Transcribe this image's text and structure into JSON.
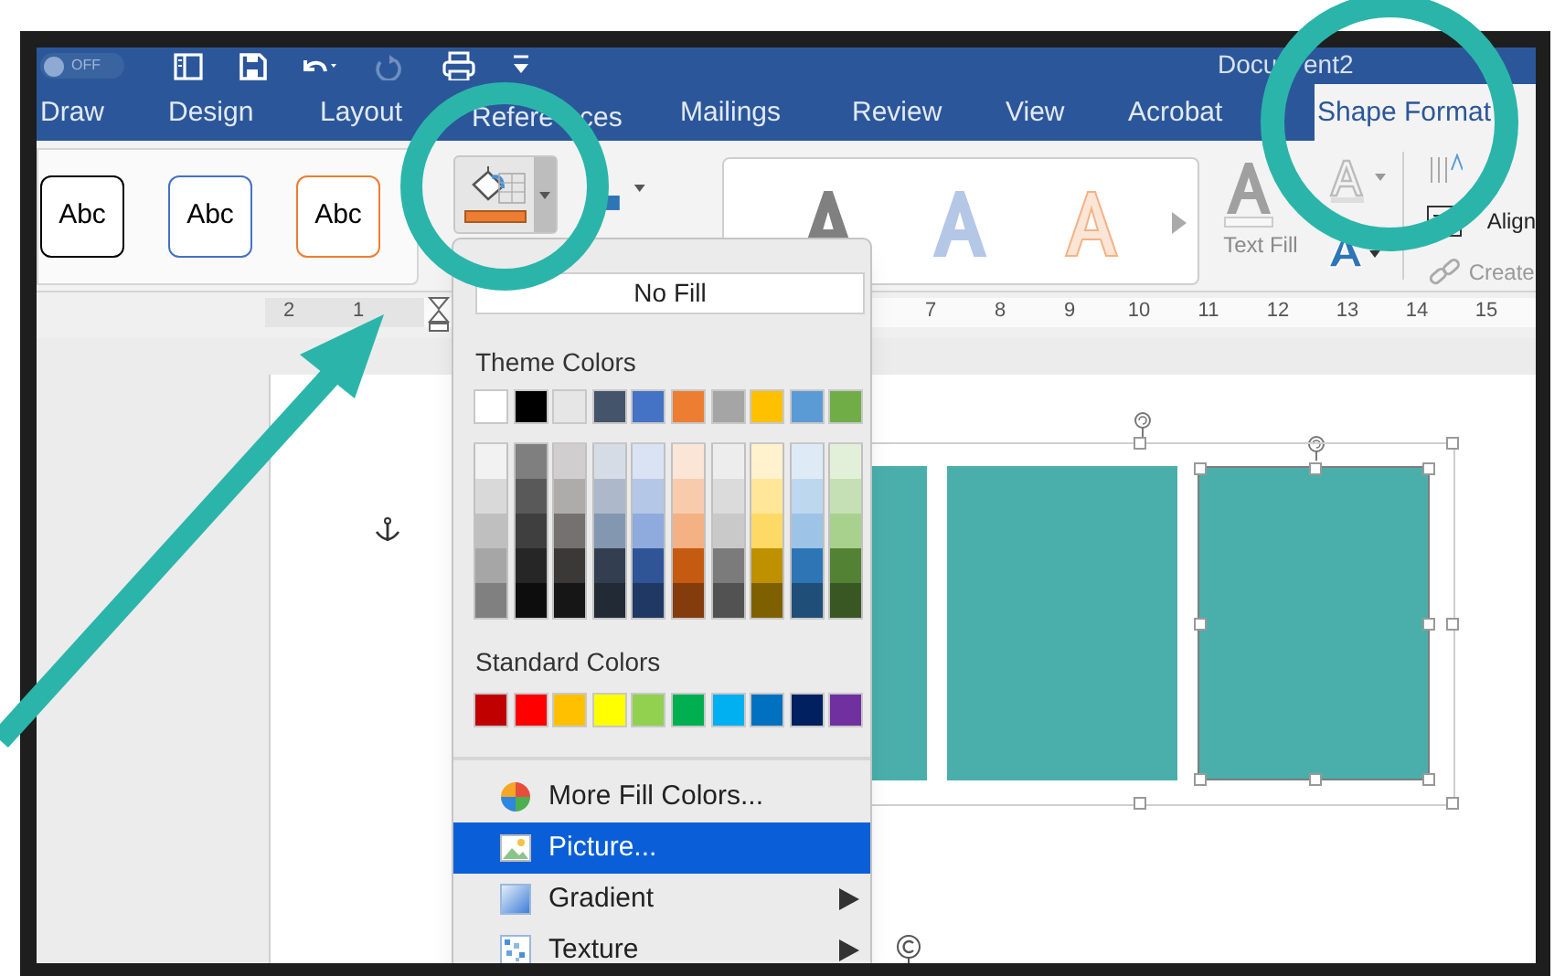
{
  "quick_access": {
    "autosave_label": "OFF",
    "autosave_on": false
  },
  "window": {
    "title_parts": [
      "Docu",
      "ent2"
    ]
  },
  "tabs": [
    {
      "label": "Draw",
      "selected": false
    },
    {
      "label": "Design",
      "selected": false
    },
    {
      "label": "Layout",
      "selected": false
    },
    {
      "label_parts": [
        "Refere",
        "ces"
      ],
      "selected": false
    },
    {
      "label": "Mailings",
      "selected": false
    },
    {
      "label": "Review",
      "selected": false
    },
    {
      "label": "View",
      "selected": false
    },
    {
      "label": "Acrobat",
      "selected": false
    },
    {
      "label": "Shape Format",
      "selected": true
    }
  ],
  "ribbon": {
    "shape_styles": [
      {
        "label": "Abc",
        "color": "#000000"
      },
      {
        "label": "Abc",
        "color": "#4472c4"
      },
      {
        "label": "Abc",
        "color": "#ed7d31"
      }
    ],
    "fill_bar": {
      "color": "#ed7d31"
    },
    "text_fill_label": "Text Fill",
    "text_group": [
      {
        "kind": "direction"
      },
      {
        "label": "Align",
        "kind": "align"
      },
      {
        "label": "Create",
        "kind": "link"
      }
    ]
  },
  "ruler": {
    "left_numbers": [
      "2",
      "1"
    ],
    "right_numbers": [
      "7",
      "8",
      "9",
      "10",
      "11",
      "12",
      "13",
      "14",
      "15"
    ]
  },
  "fill_menu": {
    "no_fill": "No Fill",
    "theme_heading": "Theme Colors",
    "theme_colors": [
      {
        "color": "#ffffff"
      },
      {
        "color": "#000000"
      },
      {
        "color": "#e7e6e6"
      },
      {
        "color": "#44546a"
      },
      {
        "color": "#4472c4"
      },
      {
        "color": "#ed7d31"
      },
      {
        "color": "#a5a5a5"
      },
      {
        "color": "#ffc000"
      },
      {
        "color": "#5b9bd5"
      },
      {
        "color": "#70ad47"
      }
    ],
    "theme_shades": [
      [
        {
          "color": "#f2f2f2"
        },
        {
          "color": "#d9d9d9"
        },
        {
          "color": "#bfbfbf"
        },
        {
          "color": "#a6a6a6"
        },
        {
          "color": "#808080"
        }
      ],
      [
        {
          "color": "#7f7f7f"
        },
        {
          "color": "#595959"
        },
        {
          "color": "#3f3f3f"
        },
        {
          "color": "#262626"
        },
        {
          "color": "#0d0d0d"
        }
      ],
      [
        {
          "color": "#d0cece"
        },
        {
          "color": "#aeabab"
        },
        {
          "color": "#757171"
        },
        {
          "color": "#3b3838"
        },
        {
          "color": "#171616"
        }
      ],
      [
        {
          "color": "#d6dce5"
        },
        {
          "color": "#adb9ca"
        },
        {
          "color": "#8497b0"
        },
        {
          "color": "#333f50"
        },
        {
          "color": "#222a35"
        }
      ],
      [
        {
          "color": "#dae3f3"
        },
        {
          "color": "#b4c7e7"
        },
        {
          "color": "#8faadc"
        },
        {
          "color": "#2f5597"
        },
        {
          "color": "#1f3864"
        }
      ],
      [
        {
          "color": "#fbe5d6"
        },
        {
          "color": "#f8cbad"
        },
        {
          "color": "#f4b183"
        },
        {
          "color": "#c55a11"
        },
        {
          "color": "#843c0c"
        }
      ],
      [
        {
          "color": "#ededed"
        },
        {
          "color": "#dbdbdb"
        },
        {
          "color": "#c9c9c9"
        },
        {
          "color": "#7b7b7b"
        },
        {
          "color": "#525252"
        }
      ],
      [
        {
          "color": "#fff2cc"
        },
        {
          "color": "#ffe699"
        },
        {
          "color": "#ffd966"
        },
        {
          "color": "#bf9000"
        },
        {
          "color": "#7f6000"
        }
      ],
      [
        {
          "color": "#deebf7"
        },
        {
          "color": "#bdd7ee"
        },
        {
          "color": "#9dc3e6"
        },
        {
          "color": "#2e75b6"
        },
        {
          "color": "#1f4e79"
        }
      ],
      [
        {
          "color": "#e2f0d9"
        },
        {
          "color": "#c5e0b4"
        },
        {
          "color": "#a9d18e"
        },
        {
          "color": "#548235"
        },
        {
          "color": "#385723"
        }
      ]
    ],
    "standard_heading": "Standard Colors",
    "standard_colors": [
      {
        "color": "#c00000"
      },
      {
        "color": "#ff0000"
      },
      {
        "color": "#ffc000"
      },
      {
        "color": "#ffff00"
      },
      {
        "color": "#92d050"
      },
      {
        "color": "#00b050"
      },
      {
        "color": "#00b0f0"
      },
      {
        "color": "#0070c0"
      },
      {
        "color": "#002060"
      },
      {
        "color": "#7030a0"
      }
    ],
    "items": [
      {
        "label": "More Fill Colors...",
        "kind": "palette",
        "selected": false,
        "has_submenu": false
      },
      {
        "label": "Picture...",
        "kind": "picture",
        "selected": true,
        "has_submenu": false
      },
      {
        "label": "Gradient",
        "kind": "gradient",
        "selected": false,
        "has_submenu": true
      },
      {
        "label": "Texture",
        "kind": "texture",
        "selected": false,
        "has_submenu": true
      }
    ]
  },
  "shapes": [
    {
      "kind": "rectangle",
      "selected": false
    },
    {
      "kind": "rectangle",
      "selected": false
    },
    {
      "kind": "rectangle",
      "selected": true
    }
  ]
}
